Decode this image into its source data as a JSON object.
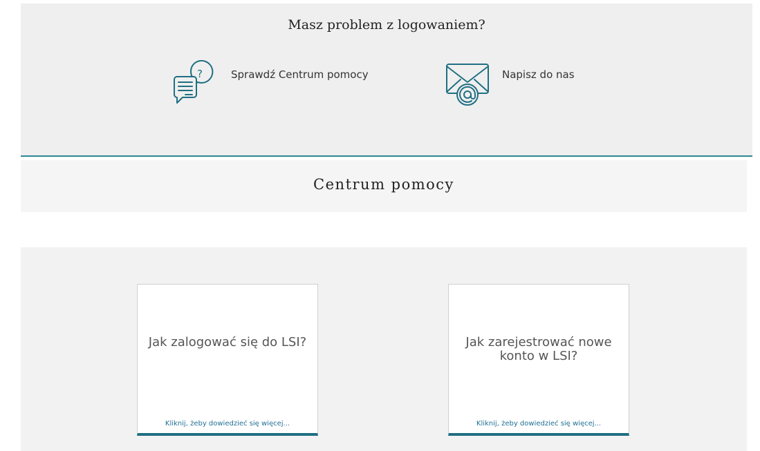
{
  "login_help": {
    "title": "Masz problem z logowaniem?",
    "links": [
      {
        "label": "Sprawdź Centrum pomocy",
        "icon": "help-chat-icon"
      },
      {
        "label": "Napisz do nas",
        "icon": "email-envelope-icon"
      }
    ]
  },
  "help_center": {
    "title": "Centrum pomocy"
  },
  "cards": [
    {
      "title": "Jak zalogować się do LSI?",
      "link": "Kliknij, żeby dowiedzieć się więcej..."
    },
    {
      "title": "Jak zarejestrować nowe konto w LSI?",
      "link": "Kliknij, żeby dowiedzieć się więcej..."
    }
  ],
  "colors": {
    "accent": "#2a8694",
    "card_border": "#1f6f82",
    "link": "#1f6f95"
  }
}
